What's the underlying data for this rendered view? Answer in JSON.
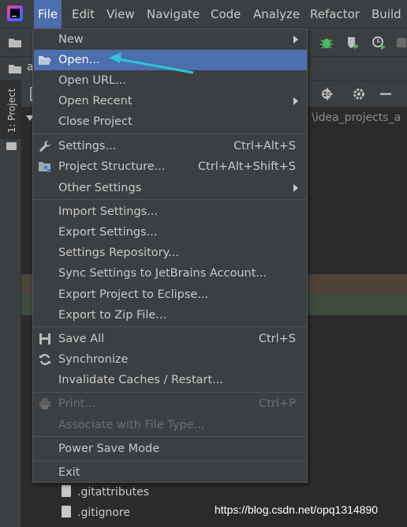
{
  "menubar": {
    "items": [
      {
        "label": "File",
        "active": true
      },
      {
        "label": "Edit"
      },
      {
        "label": "View"
      },
      {
        "label": "Navigate"
      },
      {
        "label": "Code"
      },
      {
        "label": "Analyze"
      },
      {
        "label": "Refactor"
      },
      {
        "label": "Build"
      }
    ]
  },
  "toolbar": {
    "icons": [
      "folder-icon",
      "bug-icon",
      "coverage-icon",
      "profile-icon",
      "stop-icon"
    ]
  },
  "project_tool": {
    "tab_label": "1: Project",
    "nav_partial": "a",
    "path_partial": "\\idea_projects_a"
  },
  "file_menu": {
    "items": [
      {
        "label": "New",
        "submenu": true
      },
      {
        "label": "Open...",
        "icon": "folder-open-icon",
        "selected": true
      },
      {
        "label": "Open URL..."
      },
      {
        "label": "Open Recent",
        "submenu": true
      },
      {
        "label": "Close Project"
      },
      {
        "label": "Settings...",
        "shortcut": "Ctrl+Alt+S",
        "icon": "wrench-icon"
      },
      {
        "label": "Project Structure...",
        "shortcut": "Ctrl+Alt+Shift+S",
        "icon": "project-structure-icon"
      },
      {
        "label": "Other Settings",
        "submenu": true
      },
      {
        "label": "Import Settings..."
      },
      {
        "label": "Export Settings..."
      },
      {
        "label": "Settings Repository..."
      },
      {
        "label": "Sync Settings to JetBrains Account..."
      },
      {
        "label": "Export Project to Eclipse..."
      },
      {
        "label": "Export to Zip File..."
      },
      {
        "label": "Save All",
        "shortcut": "Ctrl+S",
        "icon": "save-icon"
      },
      {
        "label": "Synchronize",
        "icon": "sync-icon"
      },
      {
        "label": "Invalidate Caches / Restart..."
      },
      {
        "label": "Print...",
        "shortcut": "Ctrl+P",
        "icon": "printer-icon",
        "disabled": true
      },
      {
        "label": "Associate with File Type...",
        "disabled": true
      },
      {
        "label": "Power Save Mode"
      },
      {
        "label": "Exit"
      }
    ]
  },
  "tree": {
    "files": [
      ".gitattributes",
      ".gitignore"
    ]
  },
  "watermark": "https://blog.csdn.net/opq1314890",
  "colors": {
    "menu_bg": "#3c3f41",
    "selection": "#4b6eaf",
    "annotation_arrow": "#2ec4d6"
  }
}
